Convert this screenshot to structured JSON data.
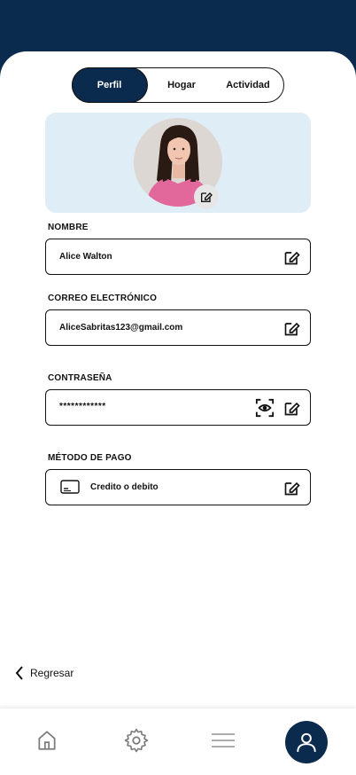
{
  "tabs": [
    {
      "label": "Perfil",
      "active": true
    },
    {
      "label": "Hogar",
      "active": false
    },
    {
      "label": "Actividad",
      "active": false
    }
  ],
  "profile": {
    "avatar_icon": "user-photo",
    "edit_icon": "edit-icon"
  },
  "fields": {
    "name": {
      "label": "NOMBRE",
      "value": "Alice Walton"
    },
    "email": {
      "label": "CORREO ELECTRÓNICO",
      "value": "AliceSabritas123@gmail.com"
    },
    "password": {
      "label": "CONTRASEÑA",
      "value": "************"
    },
    "payment": {
      "label": "MÉTODO DE PAGO",
      "value": "Credito o debito"
    }
  },
  "back": {
    "label": "Regresar"
  },
  "nav": {
    "items": [
      "home-icon",
      "settings-icon",
      "menu-icon",
      "profile-icon"
    ],
    "active": "profile-icon"
  },
  "colors": {
    "primary": "#0a2b4e",
    "avatar_card_bg": "#dfeef6"
  }
}
